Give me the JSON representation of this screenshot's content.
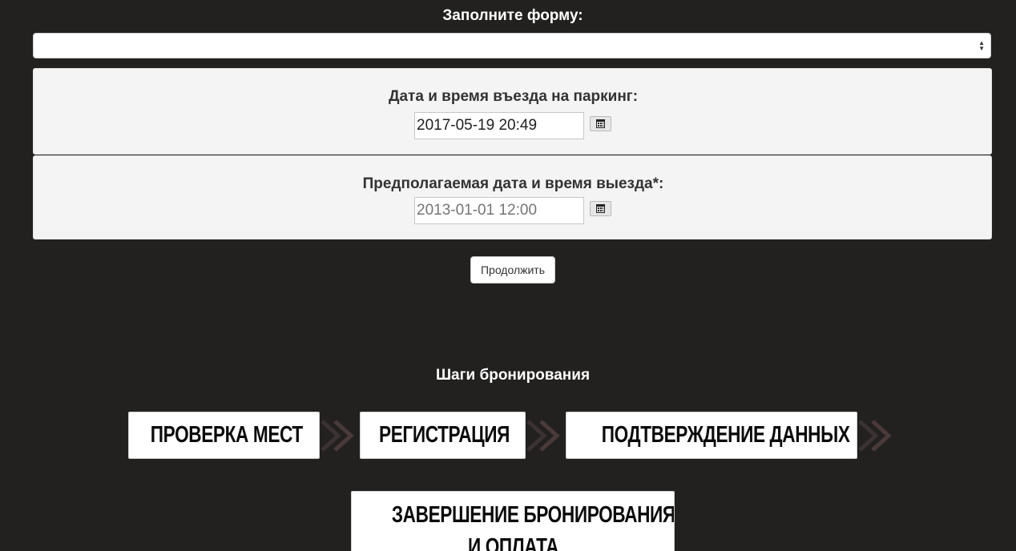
{
  "form": {
    "title": "Заполните форму:",
    "select_value": ""
  },
  "entry": {
    "label": "Дата и время въезда на паркинг:",
    "value": "2017-05-19 20:49"
  },
  "exit": {
    "label": "Предполагаемая дата и время выезда*:",
    "placeholder": "2013-01-01 12:00"
  },
  "continue_label": "Продолжить",
  "steps": {
    "title": "Шаги бронирования",
    "items": [
      {
        "label": "ПРОВЕРКА МЕСТ"
      },
      {
        "label": "РЕГИСТРАЦИЯ"
      },
      {
        "label": "ПОДТВЕРЖДЕНИЕ ДАННЫХ"
      },
      {
        "label_line1": "ЗАВЕРШЕНИЕ БРОНИРОВАНИЯ",
        "label_line2": "И ОПЛАТА"
      }
    ]
  },
  "colors": {
    "background": "#222120",
    "panel": "#f4f4f4",
    "chevron": "#4a3a3a"
  },
  "icons": [
    "calendar-icon",
    "chevron-right-icon",
    "select-arrows-icon"
  ]
}
